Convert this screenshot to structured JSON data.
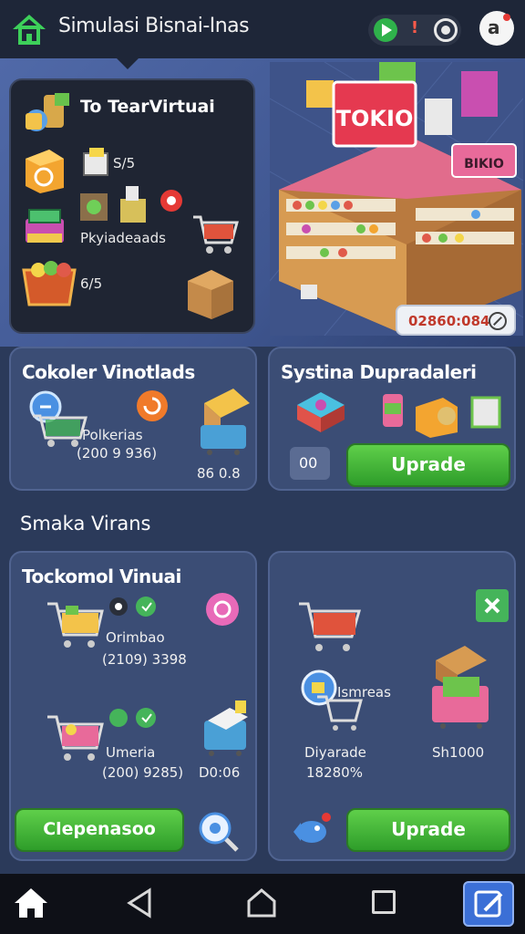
{
  "topbar": {
    "title": "Simulasi Bisnai-Inas",
    "alert_glyph": "!",
    "profile_glyph": "a",
    "icons": [
      "home-logo-icon",
      "play-icon",
      "alert-icon",
      "record-icon",
      "profile-icon"
    ]
  },
  "inventory": {
    "title": "To TearVirtuai",
    "stock_1": "S/5",
    "stock_label": "Pkyiadeaads",
    "stock_2": "6/5"
  },
  "shop": {
    "sign": "TOKIO",
    "side_sign": "BIKIO",
    "price": "02860:084"
  },
  "card_cokoler": {
    "title": "Cokoler Vinotlads",
    "label": "Polkerias",
    "value": "(200 9 936)",
    "count": "86 0.8"
  },
  "card_systina": {
    "title": "Systina Dupradaleri",
    "badge": "00",
    "upgrade_label": "Uprade"
  },
  "section": {
    "label": "Smaka Virans"
  },
  "card_tocko": {
    "title": "Tockomol Vinuai",
    "row1_label": "Orimbao",
    "row1_value": "(2109) 3398",
    "row2_label": "Umeria",
    "row2_value": "(200) 9285)",
    "row2_count": "D0:06",
    "button_label": "Clepenasoo"
  },
  "card_right": {
    "cart_label": "Ismreas",
    "label": "Diyarade",
    "value": "18280%",
    "side_value": "Sh1000",
    "upgrade_label": "Uprade"
  },
  "colors": {
    "topbar": "#1e2638",
    "card": "#3b4d75",
    "accent_green": "#2e9d2a",
    "navbar": "#0e1017",
    "edit_button": "#3b6fd6"
  }
}
